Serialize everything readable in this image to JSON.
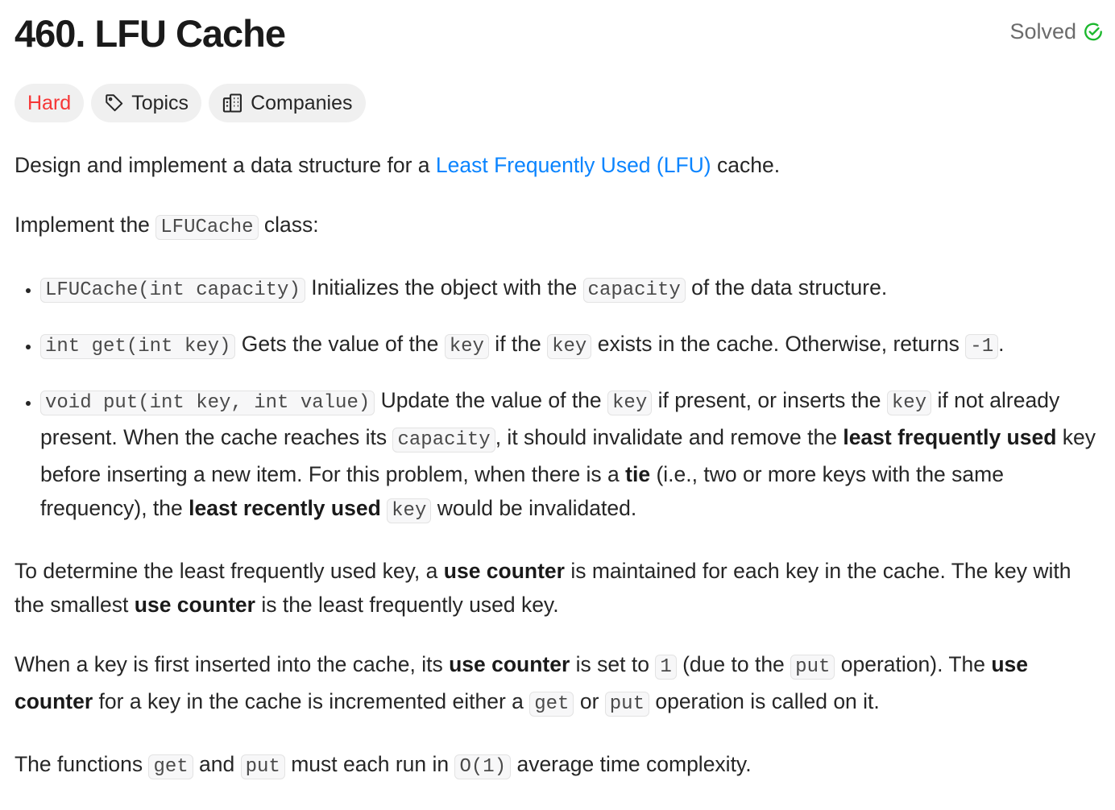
{
  "header": {
    "title": "460. LFU Cache",
    "status": "Solved",
    "status_color": "#1cb82e"
  },
  "tags": [
    {
      "label": "Hard",
      "icon": null
    },
    {
      "label": "Topics",
      "icon": "tag-icon"
    },
    {
      "label": "Companies",
      "icon": "building-icon"
    }
  ],
  "paragraphs": [
    [
      {
        "k": "t",
        "t": "Design and implement a data structure for a "
      },
      {
        "k": "a",
        "t": "Least Frequently Used (LFU)"
      },
      {
        "k": "t",
        "t": " cache."
      }
    ],
    [
      {
        "k": "t",
        "t": "Implement the "
      },
      {
        "k": "c",
        "t": "LFUCache"
      },
      {
        "k": "t",
        "t": " class:"
      }
    ]
  ],
  "bullets": [
    [
      {
        "k": "c",
        "t": "LFUCache(int capacity)"
      },
      {
        "k": "t",
        "t": " Initializes the object with the "
      },
      {
        "k": "c",
        "t": "capacity"
      },
      {
        "k": "t",
        "t": " of the data structure."
      }
    ],
    [
      {
        "k": "c",
        "t": "int get(int key)"
      },
      {
        "k": "t",
        "t": " Gets the value of the "
      },
      {
        "k": "c",
        "t": "key"
      },
      {
        "k": "t",
        "t": " if the "
      },
      {
        "k": "c",
        "t": "key"
      },
      {
        "k": "t",
        "t": " exists in the cache. Otherwise, returns "
      },
      {
        "k": "c",
        "t": "-1"
      },
      {
        "k": "t",
        "t": "."
      }
    ],
    [
      {
        "k": "c",
        "t": "void put(int key, int value)"
      },
      {
        "k": "t",
        "t": " Update the value of the "
      },
      {
        "k": "c",
        "t": "key"
      },
      {
        "k": "t",
        "t": " if present, or inserts the "
      },
      {
        "k": "c",
        "t": "key"
      },
      {
        "k": "t",
        "t": " if not already present. When the cache reaches its "
      },
      {
        "k": "c",
        "t": "capacity"
      },
      {
        "k": "t",
        "t": ", it should invalidate and remove the "
      },
      {
        "k": "b",
        "t": "least frequently used"
      },
      {
        "k": "t",
        "t": " key before inserting a new item. For this problem, when there is a "
      },
      {
        "k": "b",
        "t": "tie"
      },
      {
        "k": "t",
        "t": " (i.e., two or more keys with the same frequency), the "
      },
      {
        "k": "b",
        "t": "least recently used"
      },
      {
        "k": "t",
        "t": " "
      },
      {
        "k": "c",
        "t": "key"
      },
      {
        "k": "t",
        "t": " would be invalidated."
      }
    ]
  ],
  "paragraphs_after": [
    [
      {
        "k": "t",
        "t": "To determine the least frequently used key, a "
      },
      {
        "k": "b",
        "t": "use counter"
      },
      {
        "k": "t",
        "t": " is maintained for each key in the cache. The key with the smallest "
      },
      {
        "k": "b",
        "t": "use counter"
      },
      {
        "k": "t",
        "t": " is the least frequently used key."
      }
    ],
    [
      {
        "k": "t",
        "t": "When a key is first inserted into the cache, its "
      },
      {
        "k": "b",
        "t": "use counter"
      },
      {
        "k": "t",
        "t": " is set to "
      },
      {
        "k": "c",
        "t": "1"
      },
      {
        "k": "t",
        "t": " (due to the "
      },
      {
        "k": "c",
        "t": "put"
      },
      {
        "k": "t",
        "t": " operation). The "
      },
      {
        "k": "b",
        "t": "use counter"
      },
      {
        "k": "t",
        "t": " for a key in the cache is incremented either a "
      },
      {
        "k": "c",
        "t": "get"
      },
      {
        "k": "t",
        "t": " or "
      },
      {
        "k": "c",
        "t": "put"
      },
      {
        "k": "t",
        "t": " operation is called on it."
      }
    ],
    [
      {
        "k": "t",
        "t": "The functions "
      },
      {
        "k": "c",
        "t": "get"
      },
      {
        "k": "t",
        "t": " and "
      },
      {
        "k": "c",
        "t": "put"
      },
      {
        "k": "t",
        "t": " must each run in "
      },
      {
        "k": "c",
        "t": "O(1)"
      },
      {
        "k": "t",
        "t": " average time complexity."
      }
    ]
  ]
}
